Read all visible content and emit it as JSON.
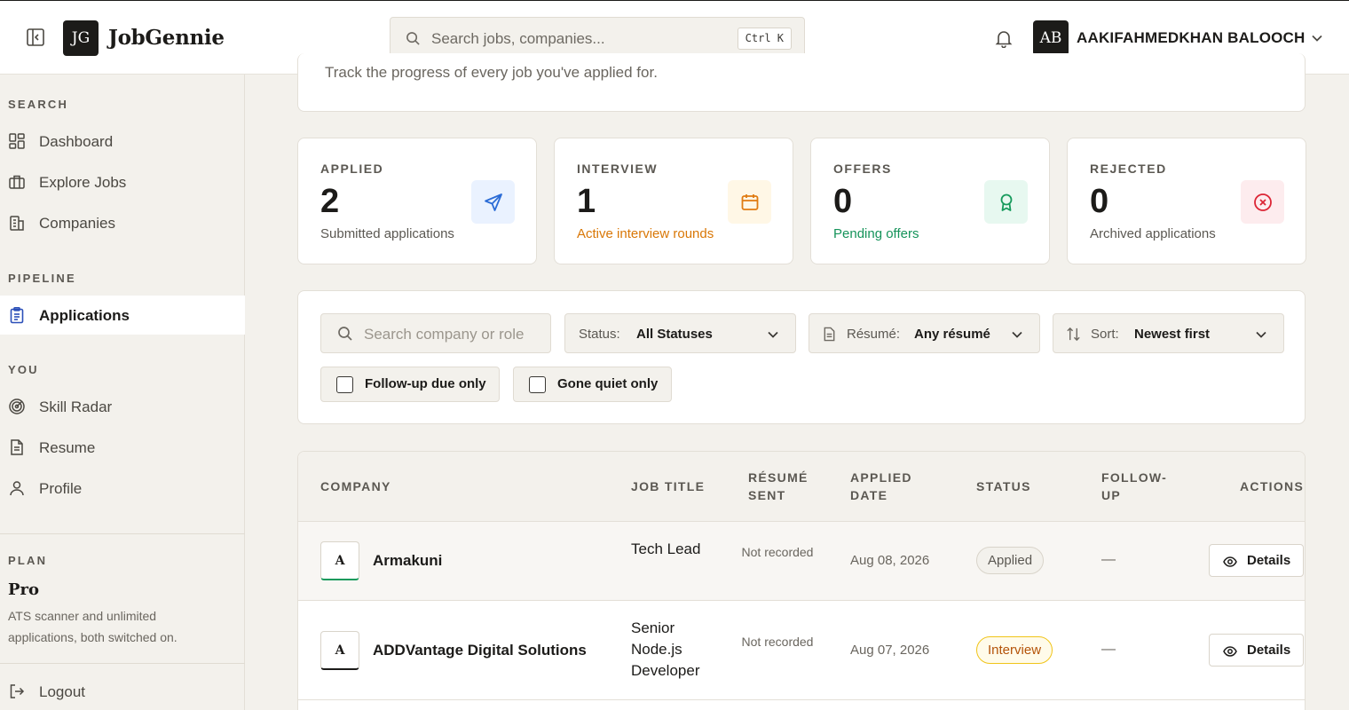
{
  "topbar": {
    "brand_mark": "JG",
    "brand_name": "JobGennie",
    "search_placeholder": "Search jobs, companies...",
    "search_shortcut": "Ctrl K",
    "user_initials": "AB",
    "user_name": "AAKIFAHMEDKHAN BALOOCH"
  },
  "sidebar": {
    "sections": {
      "search": "SEARCH",
      "pipeline": "PIPELINE",
      "you": "YOU",
      "plan": "PLAN"
    },
    "items": {
      "dashboard": "Dashboard",
      "explore_jobs": "Explore Jobs",
      "companies": "Companies",
      "applications": "Applications",
      "skill_radar": "Skill Radar",
      "resume": "Resume",
      "profile": "Profile",
      "logout": "Logout"
    },
    "plan": {
      "name": "Pro",
      "description": "ATS scanner and unlimited applications, both switched on."
    }
  },
  "main": {
    "header_subtitle": "Track the progress of every job you've applied for.",
    "stats": [
      {
        "label": "APPLIED",
        "value": "2",
        "sub": "Submitted applications",
        "sub_color": "#5b5852",
        "icon": "send-icon",
        "icon_bg": "#eaf2ff",
        "icon_color": "#2b6cd6"
      },
      {
        "label": "INTERVIEW",
        "value": "1",
        "sub": "Active interview rounds",
        "sub_color": "#d97706",
        "icon": "calendar-icon",
        "icon_bg": "#fff7e6",
        "icon_color": "#e07b12"
      },
      {
        "label": "OFFERS",
        "value": "0",
        "sub": "Pending offers",
        "sub_color": "#15935a",
        "icon": "award-icon",
        "icon_bg": "#e7f8f0",
        "icon_color": "#169a5c"
      },
      {
        "label": "REJECTED",
        "value": "0",
        "sub": "Archived applications",
        "sub_color": "#5b5852",
        "icon": "x-circle-icon",
        "icon_bg": "#fdecee",
        "icon_color": "#dc2535"
      }
    ],
    "filters": {
      "search_placeholder": "Search company or role",
      "status_label": "Status:",
      "status_value": "All Statuses",
      "resume_label": "Résumé:",
      "resume_value": "Any résumé",
      "sort_label": "Sort:",
      "sort_value": "Newest first",
      "followup_due_label": "Follow-up due only",
      "gone_quiet_label": "Gone quiet only"
    },
    "table": {
      "columns": {
        "company": "COMPANY",
        "job_title": "JOB TITLE",
        "resume_sent_1": "RÉSUMÉ",
        "resume_sent_2": "SENT",
        "applied_date_1": "APPLIED",
        "applied_date_2": "DATE",
        "status": "STATUS",
        "follow_up_1": "FOLLOW-",
        "follow_up_2": "UP",
        "actions": "ACTIONS"
      },
      "rows": [
        {
          "logo": "A",
          "company": "Armakuni",
          "job_title": "Tech Lead",
          "resume_sent": "Not recorded",
          "applied_date": "Aug 08, 2026",
          "status": "Applied",
          "follow_up": "—",
          "action": "Details",
          "accent": "#169a5c"
        },
        {
          "logo": "A",
          "company": "ADDVantage Digital Solutions",
          "job_title": "Senior Node.js Developer",
          "resume_sent": "Not recorded",
          "applied_date": "Aug 07, 2026",
          "status": "Interview",
          "follow_up": "—",
          "action": "Details",
          "accent": "#1c1b19"
        }
      ]
    }
  }
}
